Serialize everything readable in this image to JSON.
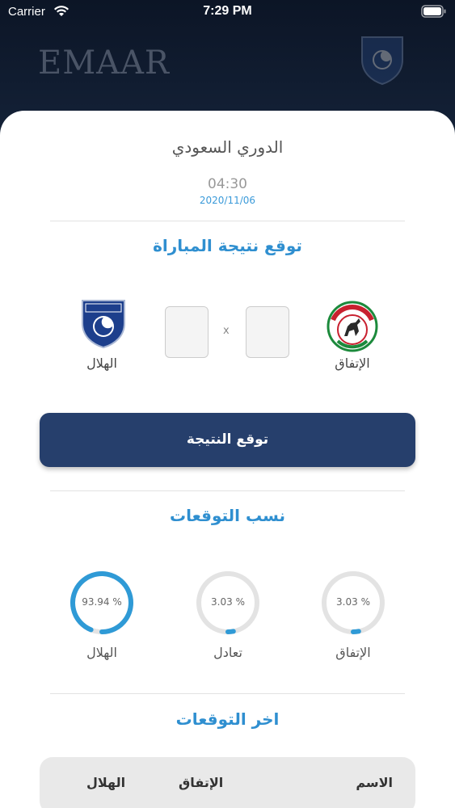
{
  "status_bar": {
    "carrier": "Carrier",
    "time": "7:29 PM"
  },
  "header": {
    "brand": "EMAAR"
  },
  "match": {
    "league": "الدوري السعودي",
    "time": "04:30",
    "date": "2020/11/06",
    "predict_title": "توقع نتيجة المباراة",
    "home_team": "الإتفاق",
    "away_team": "الهلال",
    "separator": "x",
    "home_score": "",
    "away_score": "",
    "predict_button": "توقع النتيجة"
  },
  "stats": {
    "title": "نسب التوقعات",
    "items": [
      {
        "name": "الإتفاق",
        "percent_label": "3.03 %",
        "value": 3.03
      },
      {
        "name": "تعادل",
        "percent_label": "3.03 %",
        "value": 3.03
      },
      {
        "name": "الهلال",
        "percent_label": "93.94 %",
        "value": 93.94
      }
    ],
    "track_color": "#e3e3e3",
    "fill_color": "#2f9ad6"
  },
  "latest": {
    "title": "اخر التوقعات",
    "columns": [
      "الاسم",
      "الإتفاق",
      "الهلال"
    ]
  }
}
